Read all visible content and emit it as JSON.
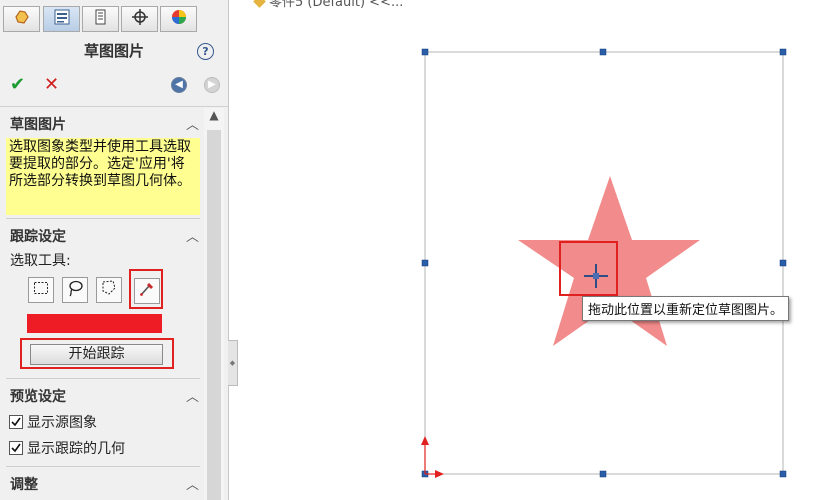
{
  "panel": {
    "title": "草图图片",
    "help_label": "?",
    "ok_symbol": "✔",
    "cancel_symbol": "✕",
    "tabs": [
      {
        "icon": "feature-manager-icon",
        "active": false
      },
      {
        "icon": "property-manager-icon",
        "active": true
      },
      {
        "icon": "configuration-manager-icon",
        "active": false
      },
      {
        "icon": "dimxpert-manager-icon",
        "active": false
      },
      {
        "icon": "display-manager-icon",
        "active": false
      }
    ]
  },
  "sections": {
    "sketch_picture": {
      "heading": "草图图片",
      "message": "选取图象类型并使用工具选取要提取的部分。选定'应用'将所选部分转换到草图几何体。"
    },
    "trace_settings": {
      "heading": "跟踪设定",
      "selector_label": "选取工具:",
      "tools": [
        "rectangle-select-icon",
        "lasso-select-icon",
        "polygon-select-icon",
        "color-picker-icon"
      ],
      "selected_color": "#ee1c24",
      "begin_button": "开始跟踪"
    },
    "preview_settings": {
      "heading": "预览设定",
      "show_source": "显示源图象",
      "show_source_checked": true,
      "show_traced": "显示跟踪的几何",
      "show_traced_checked": true
    },
    "adjust": {
      "heading": "调整"
    }
  },
  "graphics": {
    "breadcrumb": "零件5 (Default) <<...",
    "tooltip": "拖动此位置以重新定位草图图片。",
    "star_color": "#f28b8b",
    "frame_color": "#b5b5b5",
    "handle_color": "#2a5ea8"
  },
  "colors": {
    "accent_red": "#e12020",
    "note_bg": "#ffff91"
  }
}
